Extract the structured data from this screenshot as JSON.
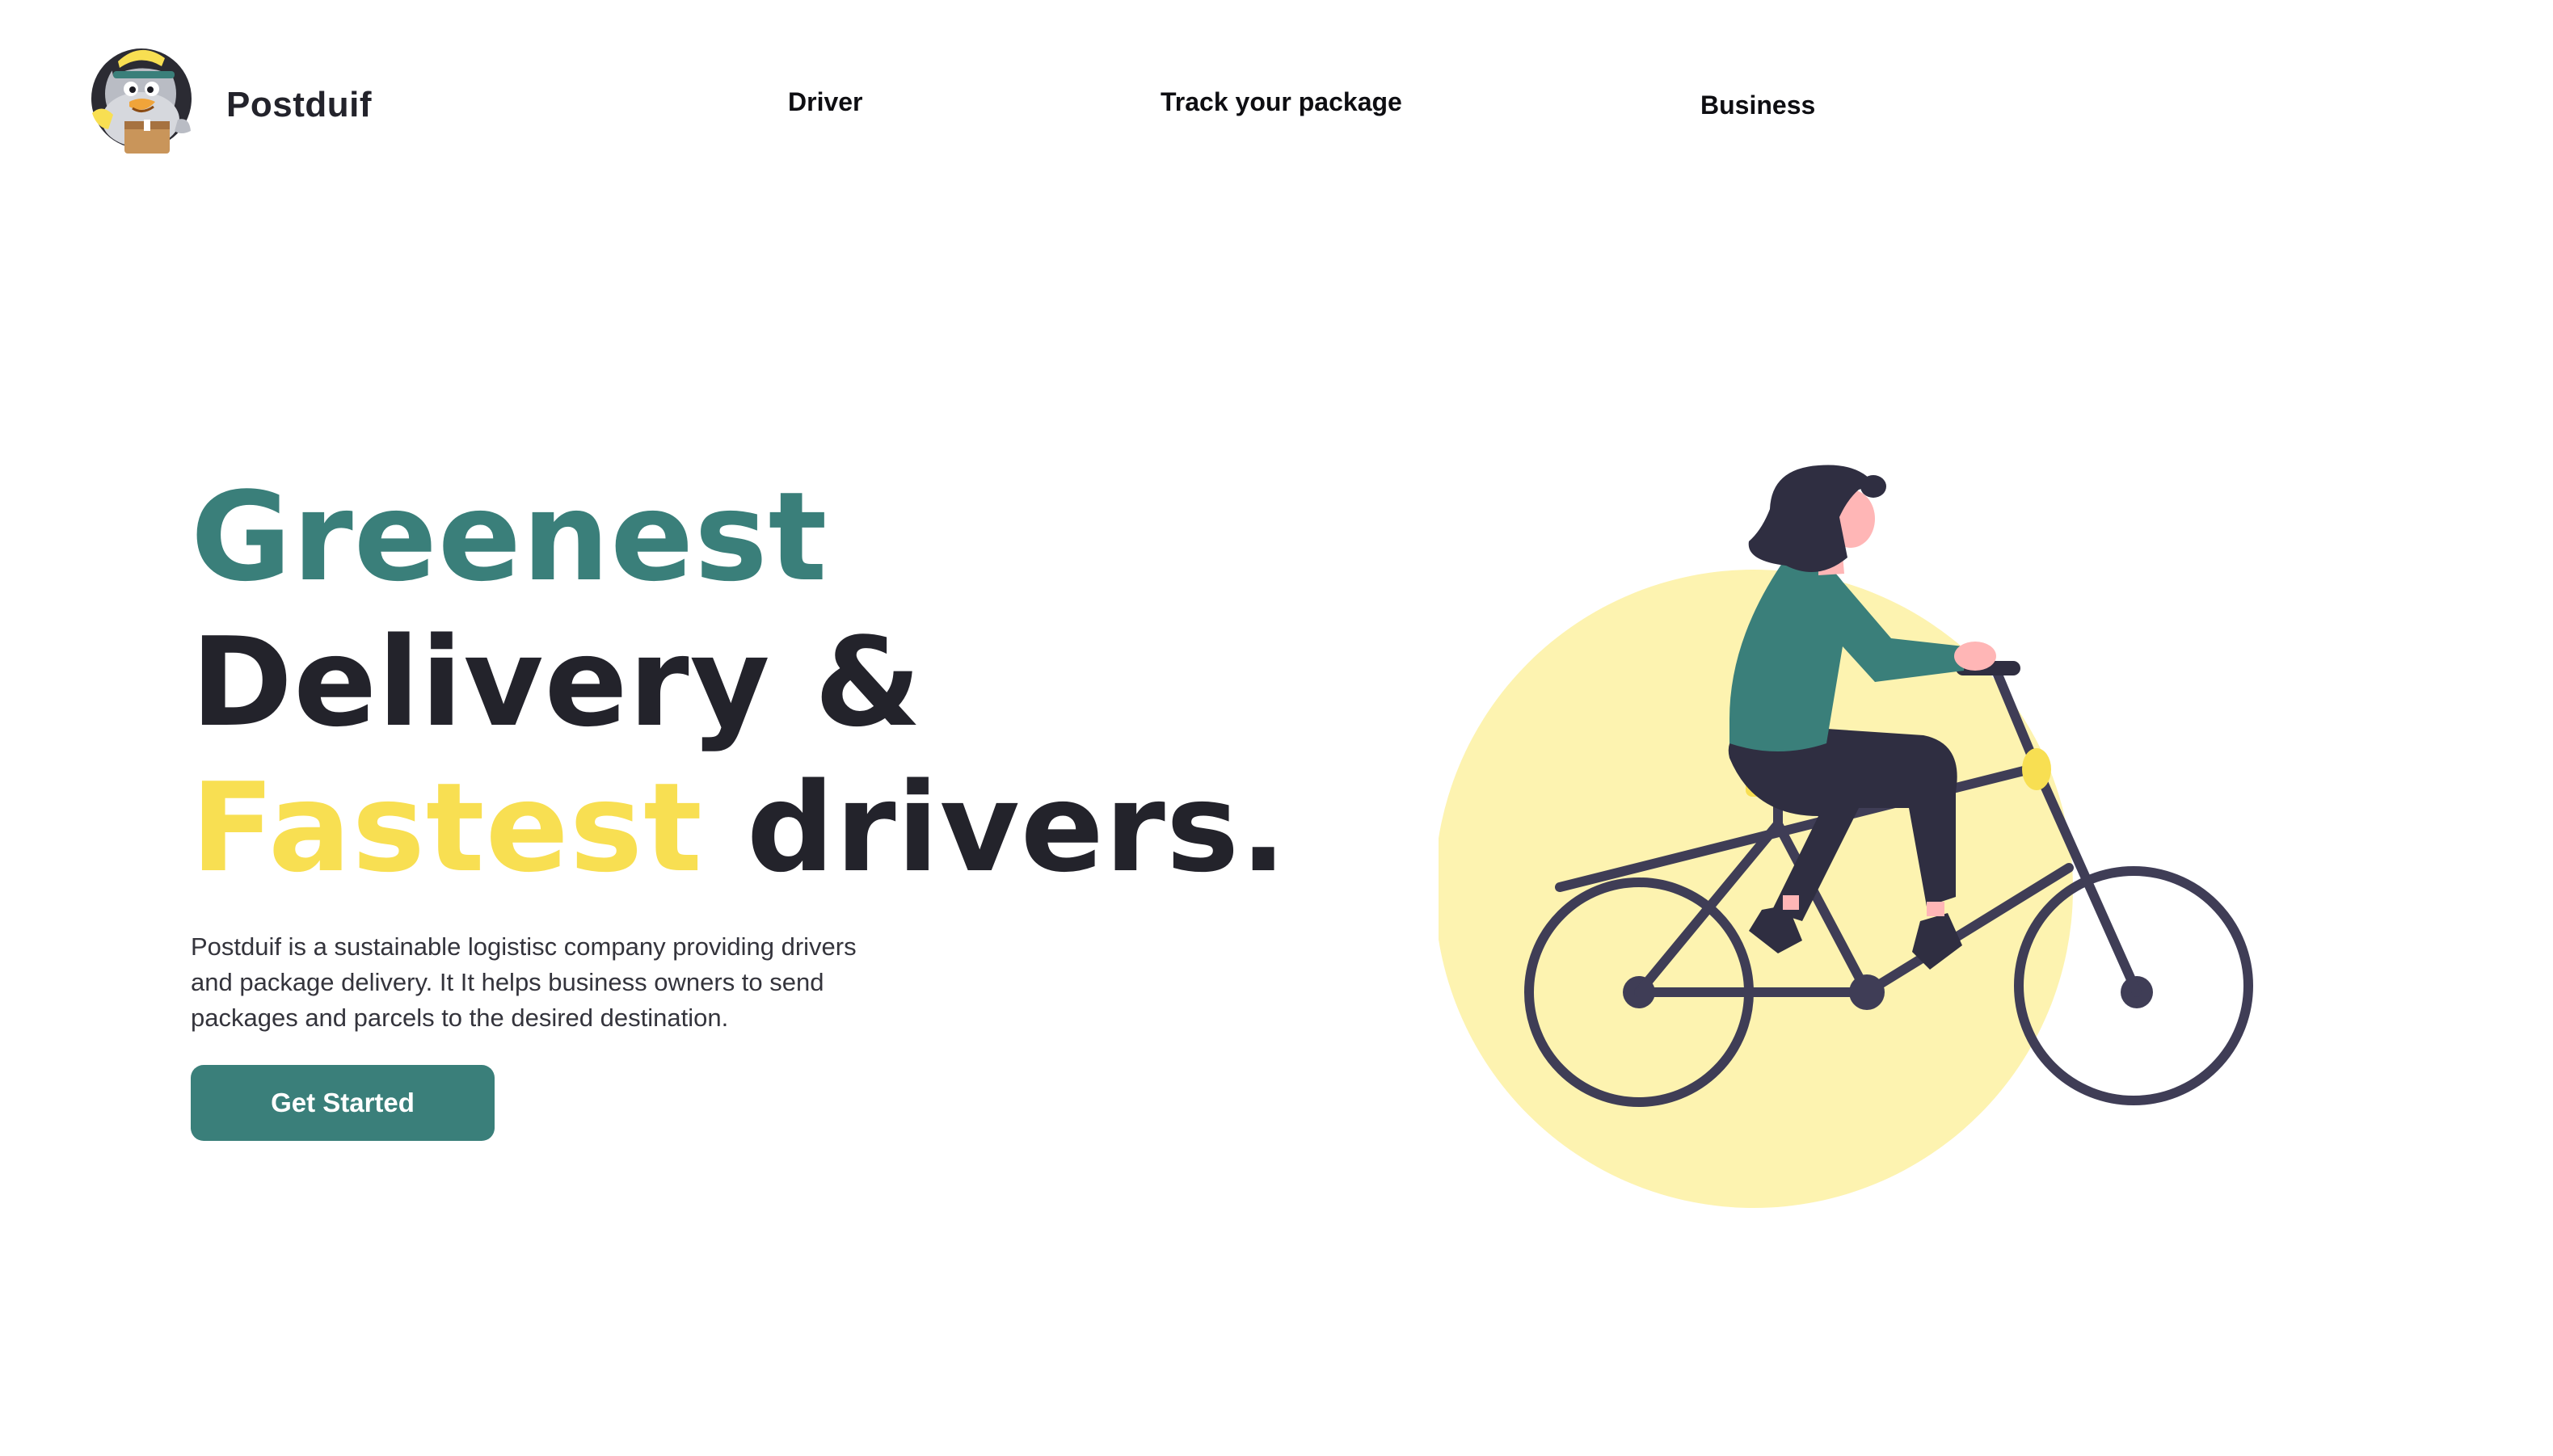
{
  "brand": {
    "name": "Postduif",
    "logo_icon": "pigeon-mail-carrier-icon"
  },
  "nav": {
    "items": [
      {
        "label": "Driver"
      },
      {
        "label": "Track your package"
      },
      {
        "label": "Business"
      }
    ]
  },
  "hero": {
    "headline": {
      "word1": "Greenest",
      "line2": "Delivery &",
      "word3": "Fastest",
      "word4": "drivers."
    },
    "description": "Postduif is  a  sustainable logistisc company providing drivers and package delivery. It It helps business owners to send packages and parcels to the desired destination.",
    "cta_label": "Get Started",
    "illustration_icon": "woman-riding-bicycle-illustration"
  },
  "colors": {
    "brand_green": "#3a7f7a",
    "accent_yellow": "#f8df52",
    "circle_yellow": "#fdf3b0",
    "text_dark": "#23232b",
    "bike_frame": "#3f3d56"
  }
}
